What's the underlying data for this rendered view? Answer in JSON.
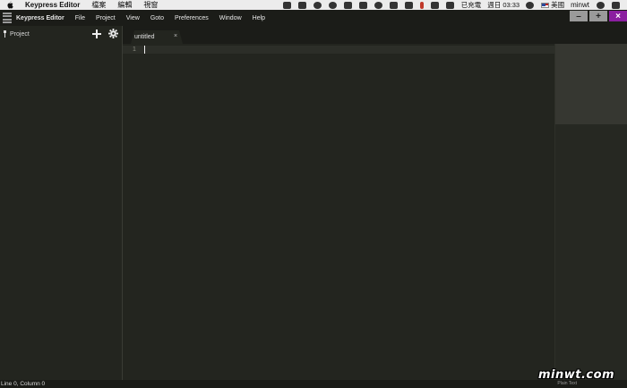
{
  "macos_menubar": {
    "menus": [
      "Keypress Editor",
      "檔案",
      "編輯",
      "視窗"
    ],
    "tray": {
      "charging_label": "已充電",
      "clock": "週日 03:33",
      "input_method": "美國",
      "username": "minwt"
    }
  },
  "app": {
    "title": "Keypress Editor",
    "menu": [
      "File",
      "Project",
      "View",
      "Goto",
      "Preferences",
      "Window",
      "Help"
    ],
    "window_buttons": {
      "minimize": "–",
      "maximize": "+",
      "close": "×"
    }
  },
  "sidebar": {
    "title": "Project"
  },
  "tabs": [
    {
      "label": "untitled",
      "close": "×",
      "active": true
    }
  ],
  "editor": {
    "line_numbers": [
      "1"
    ],
    "content": ""
  },
  "statusbar": {
    "position": "Line 0, Column 0",
    "right_text": "Plain Text"
  },
  "watermark": "minwt.com",
  "colors": {
    "background": "#23251f",
    "header": "#1b1c18",
    "close_button": "#8b1fa0",
    "window_button": "#9a9a9a",
    "menubar": "#ececec"
  }
}
